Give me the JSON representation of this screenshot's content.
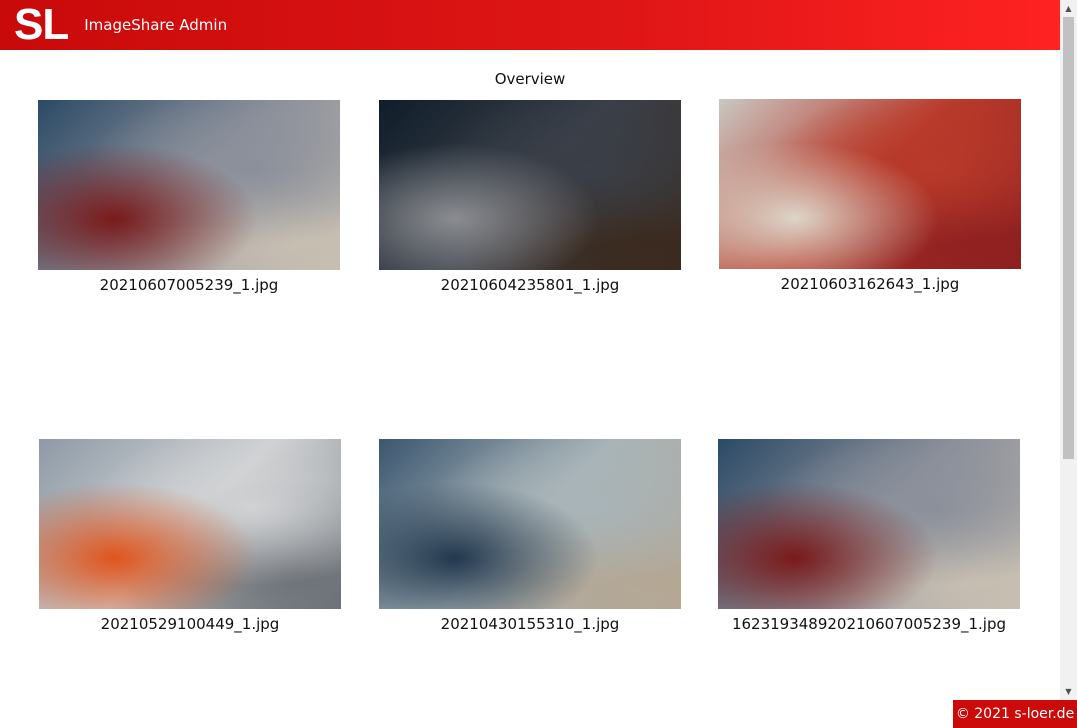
{
  "header": {
    "logo_text": "SL",
    "app_title": "ImageShare Admin"
  },
  "main": {
    "title": "Overview",
    "images": [
      {
        "filename": "20210607005239_1.jpg",
        "colors": [
          "#2b4a66",
          "#8a8f9a",
          "#7a1a1a",
          "#c8bfb2"
        ]
      },
      {
        "filename": "20210604235801_1.jpg",
        "colors": [
          "#0f1d2a",
          "#3a3f48",
          "#8a8c90",
          "#3b2a1e"
        ]
      },
      {
        "filename": "20210603162643_1.jpg",
        "colors": [
          "#c9c7c2",
          "#b93a2a",
          "#dcd5c8",
          "#8e2020"
        ]
      },
      {
        "filename": "20210529100449_1.jpg",
        "colors": [
          "#8e9aa6",
          "#d0d2d4",
          "#e0541c",
          "#6d7278"
        ]
      },
      {
        "filename": "20210430155310_1.jpg",
        "colors": [
          "#3b5670",
          "#a8b4b8",
          "#22384e",
          "#b4a794"
        ]
      },
      {
        "filename": "162319348920210607005239_1.jpg",
        "colors": [
          "#2b4a66",
          "#8a8f9a",
          "#7a1a1a",
          "#c8bfb2"
        ]
      }
    ]
  },
  "footer": {
    "copyright": "© 2021 s-loer.de"
  },
  "scrollbar": {
    "up_icon": "triangle-up",
    "down_icon": "triangle-down"
  }
}
